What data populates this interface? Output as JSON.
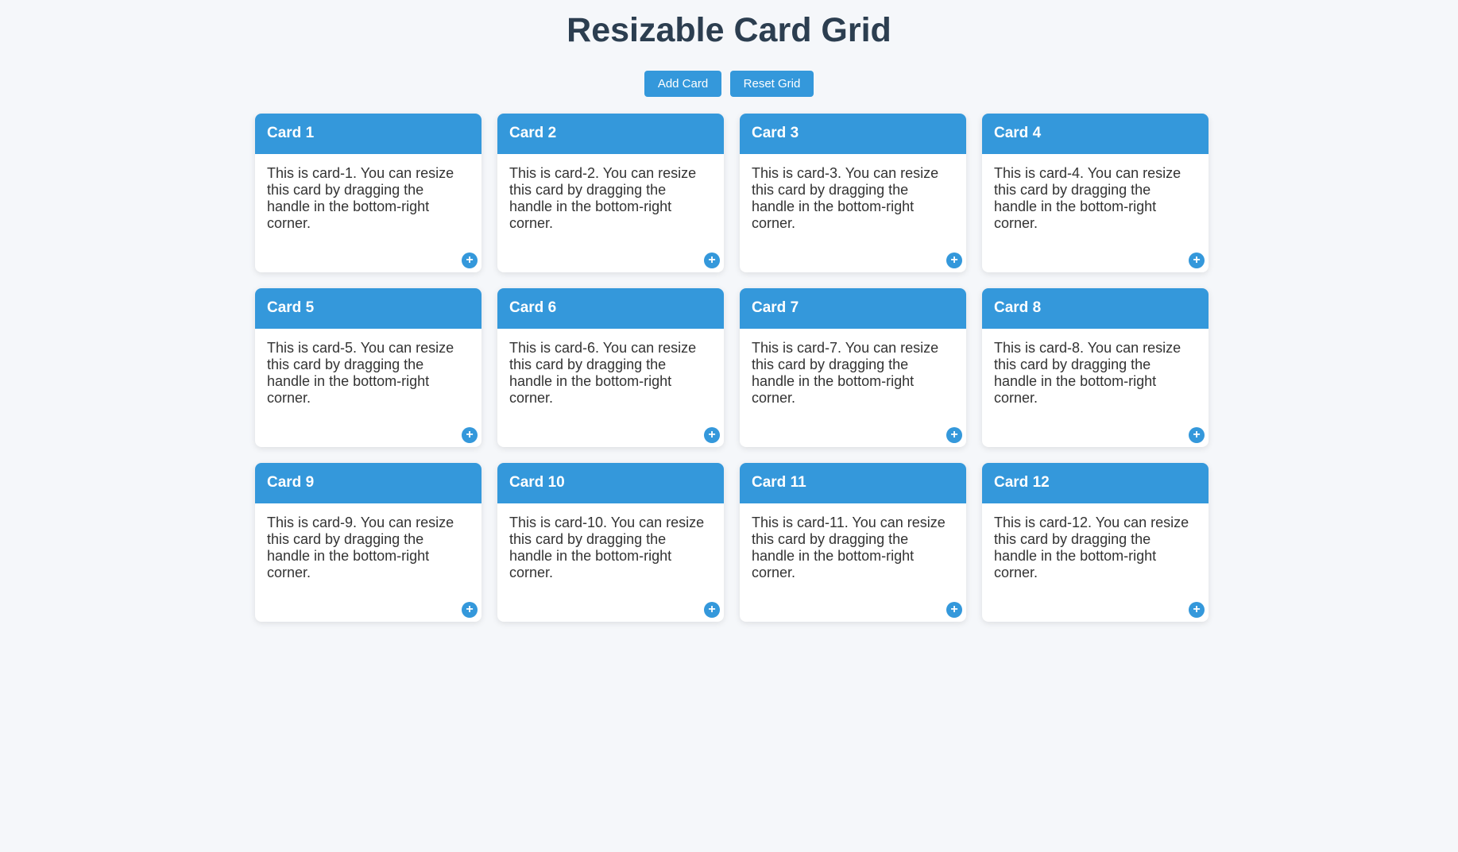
{
  "page": {
    "title": "Resizable Card Grid"
  },
  "toolbar": {
    "add_label": "Add Card",
    "reset_label": "Reset Grid"
  },
  "colors": {
    "accent": "#3498db",
    "title": "#2c3e50",
    "background": "#f5f7fa",
    "card_text": "#333333"
  },
  "resize_handle_icon": "plus-icon",
  "resize_handle_glyph": "+",
  "cards": [
    {
      "title": "Card 1",
      "body": "This is card-1. You can resize this card by dragging the handle in the bottom-right corner."
    },
    {
      "title": "Card 2",
      "body": "This is card-2. You can resize this card by dragging the handle in the bottom-right corner."
    },
    {
      "title": "Card 3",
      "body": "This is card-3. You can resize this card by dragging the handle in the bottom-right corner."
    },
    {
      "title": "Card 4",
      "body": "This is card-4. You can resize this card by dragging the handle in the bottom-right corner."
    },
    {
      "title": "Card 5",
      "body": "This is card-5. You can resize this card by dragging the handle in the bottom-right corner."
    },
    {
      "title": "Card 6",
      "body": "This is card-6. You can resize this card by dragging the handle in the bottom-right corner."
    },
    {
      "title": "Card 7",
      "body": "This is card-7. You can resize this card by dragging the handle in the bottom-right corner."
    },
    {
      "title": "Card 8",
      "body": "This is card-8. You can resize this card by dragging the handle in the bottom-right corner."
    },
    {
      "title": "Card 9",
      "body": "This is card-9. You can resize this card by dragging the handle in the bottom-right corner."
    },
    {
      "title": "Card 10",
      "body": "This is card-10. You can resize this card by dragging the handle in the bottom-right corner."
    },
    {
      "title": "Card 11",
      "body": "This is card-11. You can resize this card by dragging the handle in the bottom-right corner."
    },
    {
      "title": "Card 12",
      "body": "This is card-12. You can resize this card by dragging the handle in the bottom-right corner."
    }
  ]
}
